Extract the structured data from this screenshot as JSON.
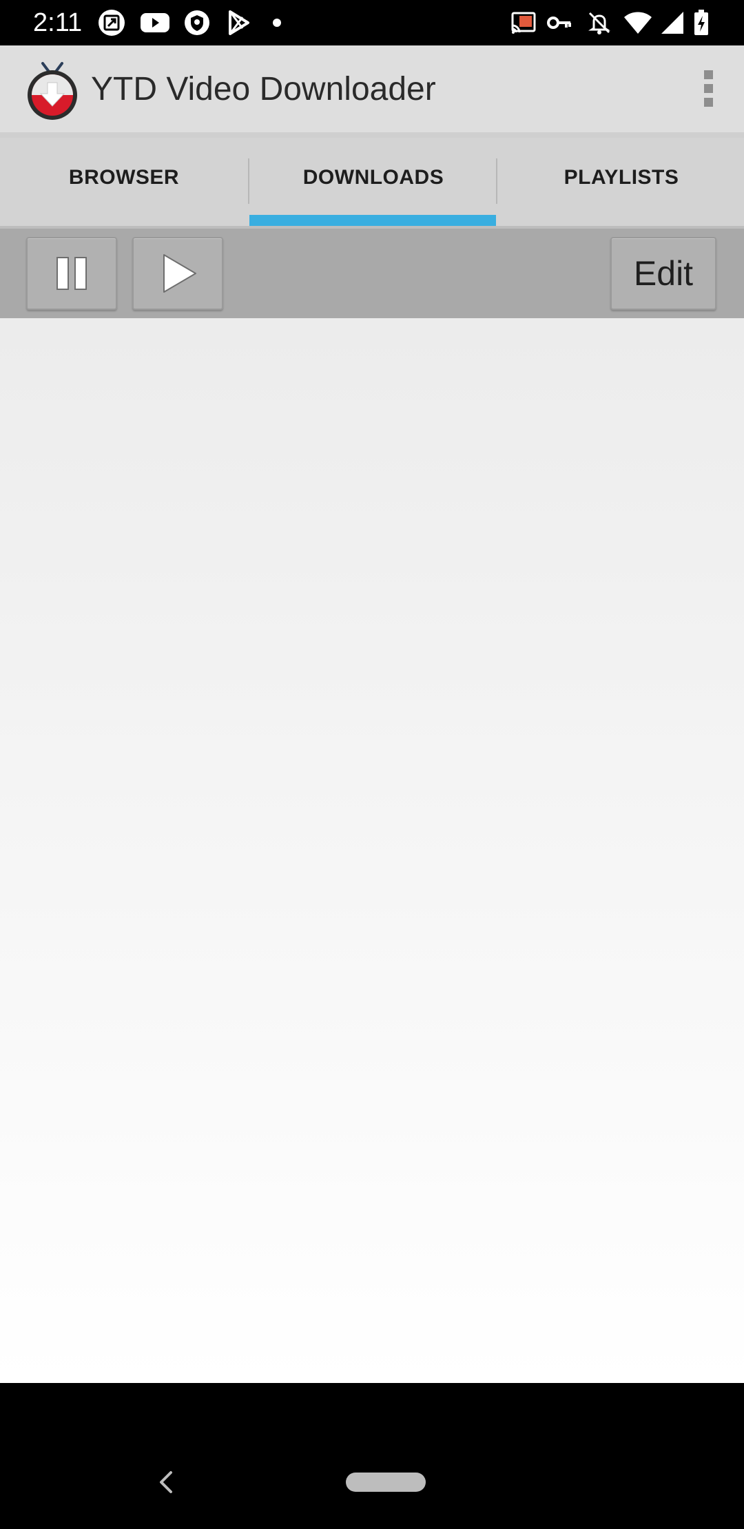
{
  "status_bar": {
    "time": "2:11",
    "left_icons": [
      "notification-screenshot-icon",
      "youtube-icon",
      "shield-icon",
      "play-store-icon",
      "dot-icon"
    ],
    "right_icons": [
      "cast-icon",
      "vpn-key-icon",
      "alarm-off-icon",
      "wifi-icon",
      "signal-icon",
      "battery-charging-icon"
    ]
  },
  "app_bar": {
    "title": "YTD Video Downloader",
    "logo_icon": "ytd-logo-icon",
    "menu_icon": "overflow-menu-icon"
  },
  "tabs": [
    {
      "label": "BROWSER",
      "selected": false
    },
    {
      "label": "DOWNLOADS",
      "selected": true
    },
    {
      "label": "PLAYLISTS",
      "selected": false
    }
  ],
  "toolbar": {
    "pause_icon": "pause-icon",
    "play_icon": "play-icon",
    "edit_label": "Edit"
  },
  "colors": {
    "tab_indicator": "#39aee0",
    "app_bar_bg": "#dedede",
    "toolbar_bg": "#a9a9a9"
  },
  "nav_bar": {
    "back_icon": "back-icon",
    "home_icon": "home-pill-icon"
  }
}
